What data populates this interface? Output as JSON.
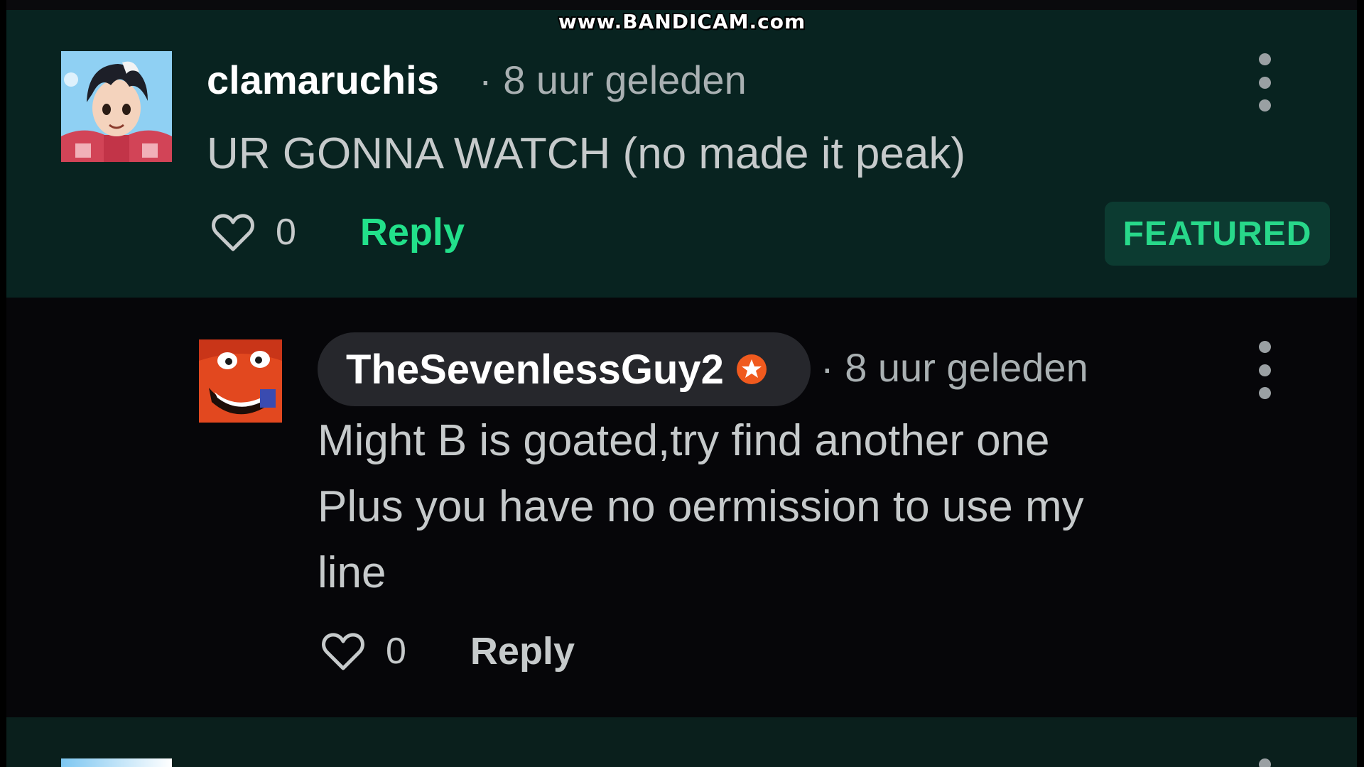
{
  "watermark": "www.BANDICAM.com",
  "comments": [
    {
      "username": "clamaruchis",
      "time": "· 8 uur geleden",
      "text": "UR GONNA WATCH (no made it peak)",
      "likes": "0",
      "reply_label": "Reply",
      "badge": "FEATURED",
      "avatar_icon": "anime-boy-avatar",
      "menu_icon": "more-vertical-icon"
    },
    {
      "username": "TheSevenlessGuy2",
      "time": "· 8 uur geleden",
      "text_lines": [
        "Might B is goated,try find another one",
        "Plus you have no oermission to use my",
        "line"
      ],
      "likes": "0",
      "reply_label": "Reply",
      "user_badge_icon": "star-badge-icon",
      "avatar_icon": "orange-cartoon-avatar",
      "menu_icon": "more-vertical-icon"
    }
  ],
  "colors": {
    "featured_bg": "#082320",
    "reply_bg": "#060609",
    "accent_green": "#22e08a",
    "badge_bg": "#0c3b31",
    "star_orange": "#f05a1e"
  }
}
